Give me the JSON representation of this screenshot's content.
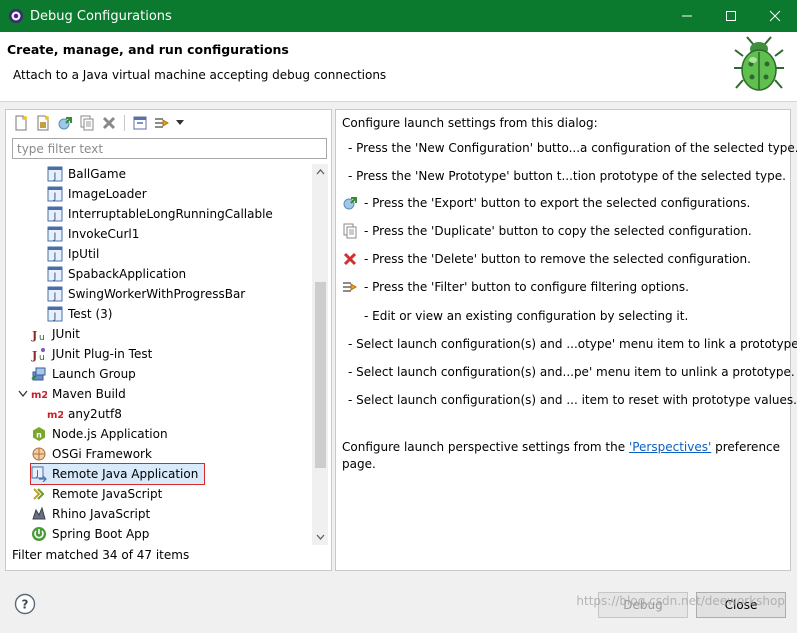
{
  "window": {
    "title": "Debug Configurations",
    "controls": [
      "minimize",
      "maximize",
      "close"
    ]
  },
  "header": {
    "title": "Create, manage, and run configurations",
    "description": "Attach to a Java virtual machine accepting debug connections"
  },
  "left_panel": {
    "toolbar": [
      "new-configuration-icon",
      "new-prototype-icon",
      "export-icon",
      "duplicate-icon",
      "delete-icon",
      "collapse-all-icon",
      "filter-icon",
      "dropdown-arrow-icon"
    ],
    "filter_placeholder": "type filter text",
    "filter_value": "",
    "tree": [
      {
        "label": "BallGame",
        "icon": "java-app-icon"
      },
      {
        "label": "ImageLoader",
        "icon": "java-app-icon"
      },
      {
        "label": "InterruptableLongRunningCallable",
        "icon": "java-app-icon"
      },
      {
        "label": "InvokeCurl1",
        "icon": "java-app-icon"
      },
      {
        "label": "IpUtil",
        "icon": "java-app-icon"
      },
      {
        "label": "SpabackApplication",
        "icon": "java-app-icon"
      },
      {
        "label": "SwingWorkerWithProgressBar",
        "icon": "java-app-icon"
      },
      {
        "label": "Test (3)",
        "icon": "java-app-icon"
      },
      {
        "label": "JUnit",
        "icon": "junit-icon"
      },
      {
        "label": "JUnit Plug-in Test",
        "icon": "junit-plugin-icon"
      },
      {
        "label": "Launch Group",
        "icon": "launch-group-icon"
      },
      {
        "label": "Maven Build",
        "icon": "maven-icon",
        "expanded": true
      },
      {
        "label": "any2utf8",
        "icon": "maven-icon"
      },
      {
        "label": "Node.js Application",
        "icon": "nodejs-icon"
      },
      {
        "label": "OSGi Framework",
        "icon": "osgi-icon"
      },
      {
        "label": "Remote Java Application",
        "icon": "remote-java-icon",
        "selected": true
      },
      {
        "label": "Remote JavaScript",
        "icon": "remote-javascript-icon"
      },
      {
        "label": "Rhino JavaScript",
        "icon": "rhino-icon"
      },
      {
        "label": "Spring Boot App",
        "icon": "spring-boot-icon"
      }
    ],
    "status": "Filter matched 34 of 47 items"
  },
  "right_panel": {
    "intro": "Configure launch settings from this dialog:",
    "lines": [
      {
        "text": "- Press the 'New Configuration' butto...a configuration of the selected type.",
        "icon": ""
      },
      {
        "text": "- Press the 'New Prototype' button t...tion prototype of the selected type.",
        "icon": ""
      },
      {
        "text": "- Press the 'Export' button to export the selected configurations.",
        "icon": "export-icon"
      },
      {
        "text": "- Press the 'Duplicate' button to copy the selected configuration.",
        "icon": "duplicate-icon"
      },
      {
        "text": "- Press the 'Delete' button to remove the selected configuration.",
        "icon": "delete-icon"
      },
      {
        "text": "- Press the 'Filter' button to configure filtering options.",
        "icon": "filter-icon"
      },
      {
        "text": "- Edit or view an existing configuration by selecting it.",
        "icon": ""
      },
      {
        "text": "- Select launch configuration(s) and ...otype' menu item to link a prototype.",
        "icon": ""
      },
      {
        "text": "- Select launch configuration(s) and...pe' menu item to unlink a prototype.",
        "icon": ""
      },
      {
        "text": "- Select launch configuration(s) and ... item to reset with prototype values.",
        "icon": ""
      }
    ],
    "perspectives_prefix": "Configure launch perspective settings from the ",
    "perspectives_link": "'Perspectives'",
    "perspectives_suffix": " preference",
    "perspectives_tail": "page."
  },
  "footer": {
    "debug_label": "Debug",
    "close_label": "Close",
    "watermark": "https://blog.csdn.net/deeworkshop"
  },
  "colors": {
    "titlebar": "#0b7a2e",
    "selection": "#d9ebfb",
    "highlight_border": "#d42a2a",
    "link": "#0b61c2"
  }
}
